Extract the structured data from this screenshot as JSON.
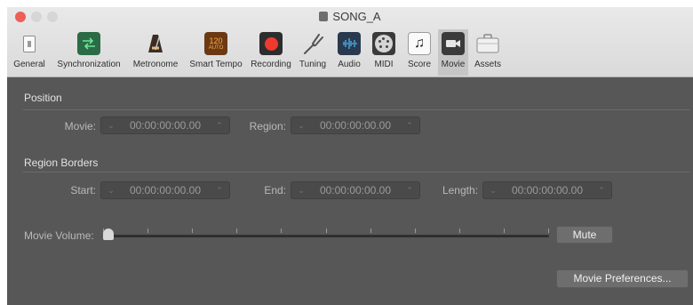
{
  "window": {
    "title": "SONG_A"
  },
  "toolbar": {
    "tabs": [
      {
        "label": "General",
        "icon": "general-icon"
      },
      {
        "label": "Synchronization",
        "icon": "synchronization-icon"
      },
      {
        "label": "Metronome",
        "icon": "metronome-icon"
      },
      {
        "label": "Smart Tempo",
        "icon": "smart-tempo-icon",
        "badge_line1": "120",
        "badge_line2": "AUTO"
      },
      {
        "label": "Recording",
        "icon": "recording-icon"
      },
      {
        "label": "Tuning",
        "icon": "tuning-fork-icon"
      },
      {
        "label": "Audio",
        "icon": "audio-waveform-icon"
      },
      {
        "label": "MIDI",
        "icon": "midi-connector-icon"
      },
      {
        "label": "Score",
        "icon": "score-note-icon"
      },
      {
        "label": "Movie",
        "icon": "movie-camera-icon",
        "active": true
      },
      {
        "label": "Assets",
        "icon": "assets-briefcase-icon"
      }
    ]
  },
  "position": {
    "heading": "Position",
    "movie_label": "Movie:",
    "movie_value": "00:00:00:00.00",
    "region_label": "Region:",
    "region_value": "00:00:00:00.00"
  },
  "region_borders": {
    "heading": "Region Borders",
    "start_label": "Start:",
    "start_value": "00:00:00:00.00",
    "end_label": "End:",
    "end_value": "00:00:00:00.00",
    "length_label": "Length:",
    "length_value": "00:00:00:00.00"
  },
  "volume": {
    "label": "Movie Volume:",
    "level": 0,
    "mute_label": "Mute"
  },
  "preferences_button": "Movie Preferences..."
}
